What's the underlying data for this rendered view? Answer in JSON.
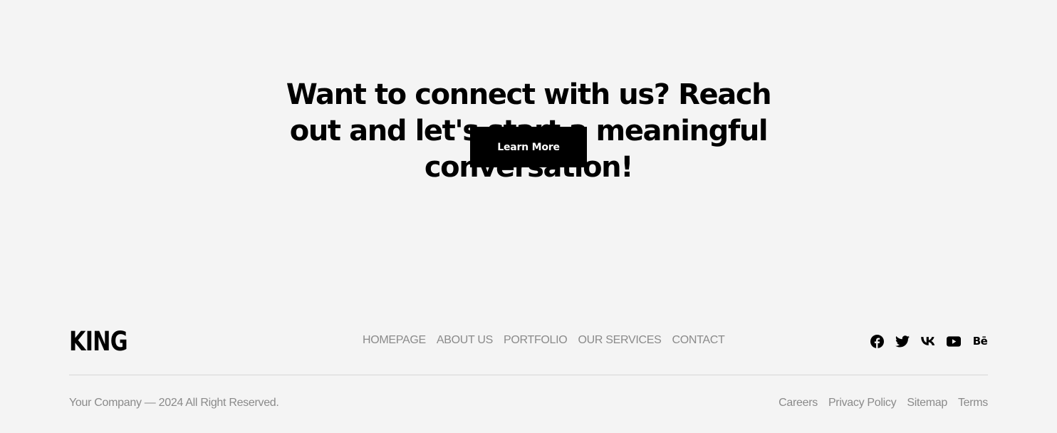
{
  "cta": {
    "heading": "Want to connect with us? Reach out and let's start a meaningful conversation!",
    "button_label": "Learn More",
    "button_bg": "#000000",
    "button_text_color": "#ffffff"
  },
  "footer": {
    "logo": "KING",
    "nav": [
      {
        "label": "HOMEPAGE"
      },
      {
        "label": "ABOUT US"
      },
      {
        "label": "PORTFOLIO"
      },
      {
        "label": "OUR SERVICES"
      },
      {
        "label": "CONTACT"
      }
    ],
    "social": [
      {
        "icon": "facebook-icon"
      },
      {
        "icon": "twitter-icon"
      },
      {
        "icon": "vk-icon"
      },
      {
        "icon": "youtube-icon"
      },
      {
        "icon": "behance-icon",
        "glyph": "Bē"
      }
    ],
    "copyright": "Your Company — 2024 All Right Reserved.",
    "legal_links": [
      {
        "label": "Careers"
      },
      {
        "label": "Privacy Policy"
      },
      {
        "label": "Sitemap"
      },
      {
        "label": "Terms"
      }
    ]
  },
  "colors": {
    "background": "#f4f4f4",
    "muted_text": "#8a8a8a",
    "divider": "#d6d6d6"
  }
}
